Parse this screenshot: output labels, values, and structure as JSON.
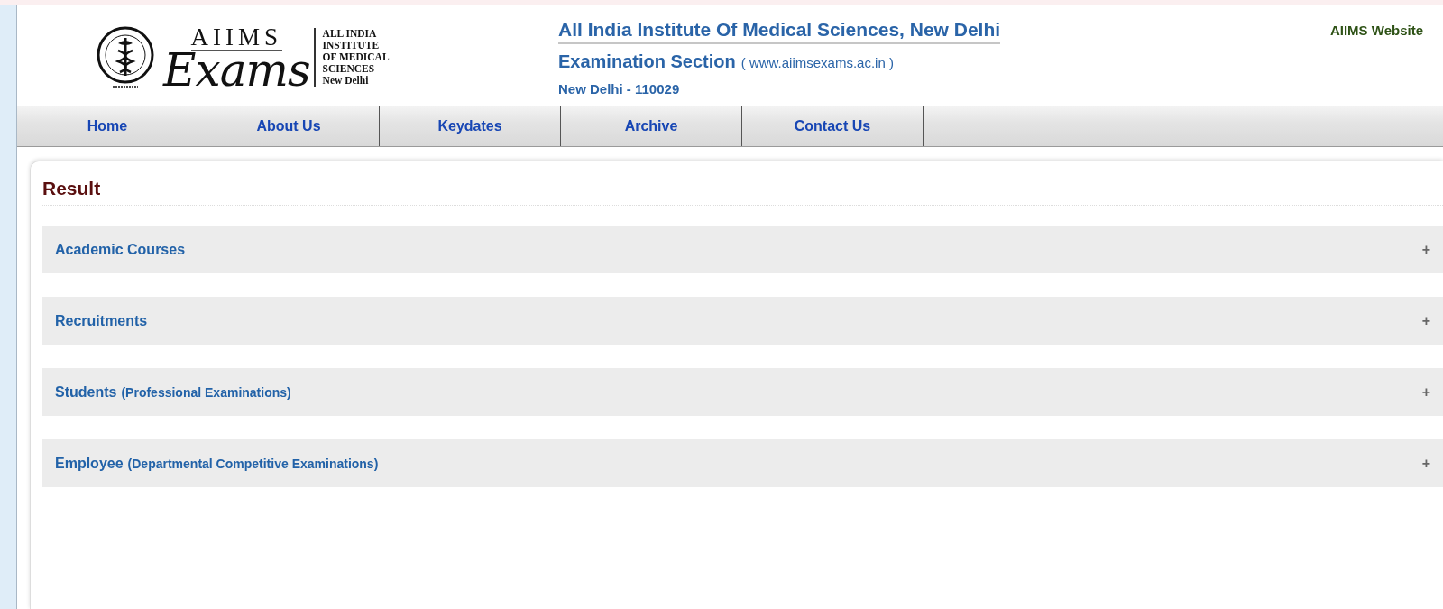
{
  "logo": {
    "wordmark": "AIIMS",
    "script": "Exams",
    "side_lines": [
      "ALL INDIA",
      "INSTITUTE",
      "OF MEDICAL",
      "SCIENCES",
      "New Delhi"
    ]
  },
  "header": {
    "title": "All India Institute Of Medical Sciences, New Delhi",
    "section": "Examination Section",
    "website": "( www.aiimsexams.ac.in )",
    "address": "New Delhi - 110029",
    "link": "AIIMS Website"
  },
  "nav": [
    {
      "label": "Home"
    },
    {
      "label": "About Us"
    },
    {
      "label": "Keydates"
    },
    {
      "label": "Archive"
    },
    {
      "label": "Contact Us"
    }
  ],
  "page_title": "Result",
  "sections": [
    {
      "title": "Academic Courses",
      "toggle": "+"
    },
    {
      "title": "Recruitments",
      "toggle": "+"
    },
    {
      "title": "Students",
      "note": "(Professional Examinations)",
      "toggle": "+"
    },
    {
      "title": "Employee",
      "note": "(Departmental Competitive Examinations)",
      "toggle": "+"
    }
  ]
}
